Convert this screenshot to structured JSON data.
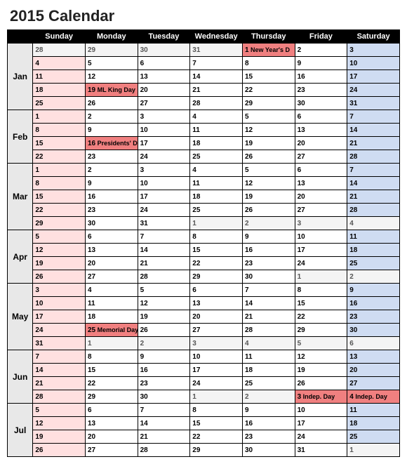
{
  "title": "2015 Calendar",
  "headers": [
    "",
    "Sunday",
    "Monday",
    "Tuesday",
    "Wednesday",
    "Thursday",
    "Friday",
    "Saturday"
  ],
  "months": [
    {
      "label": "Jan",
      "weeks": [
        [
          {
            "d": "28",
            "g": true
          },
          {
            "d": "29",
            "g": true
          },
          {
            "d": "30",
            "g": true
          },
          {
            "d": "31",
            "g": true
          },
          {
            "d": "1",
            "e": "New Year's D"
          },
          {
            "d": "2"
          },
          {
            "d": "3"
          }
        ],
        [
          {
            "d": "4"
          },
          {
            "d": "5"
          },
          {
            "d": "6"
          },
          {
            "d": "7"
          },
          {
            "d": "8"
          },
          {
            "d": "9"
          },
          {
            "d": "10"
          }
        ],
        [
          {
            "d": "11"
          },
          {
            "d": "12"
          },
          {
            "d": "13"
          },
          {
            "d": "14"
          },
          {
            "d": "15"
          },
          {
            "d": "16"
          },
          {
            "d": "17"
          }
        ],
        [
          {
            "d": "18"
          },
          {
            "d": "19",
            "e": "ML King Day"
          },
          {
            "d": "20"
          },
          {
            "d": "21"
          },
          {
            "d": "22"
          },
          {
            "d": "23"
          },
          {
            "d": "24"
          }
        ],
        [
          {
            "d": "25"
          },
          {
            "d": "26"
          },
          {
            "d": "27"
          },
          {
            "d": "28"
          },
          {
            "d": "29"
          },
          {
            "d": "30"
          },
          {
            "d": "31"
          }
        ]
      ]
    },
    {
      "label": "Feb",
      "weeks": [
        [
          {
            "d": "1"
          },
          {
            "d": "2"
          },
          {
            "d": "3"
          },
          {
            "d": "4"
          },
          {
            "d": "5"
          },
          {
            "d": "6"
          },
          {
            "d": "7"
          }
        ],
        [
          {
            "d": "8"
          },
          {
            "d": "9"
          },
          {
            "d": "10"
          },
          {
            "d": "11"
          },
          {
            "d": "12"
          },
          {
            "d": "13"
          },
          {
            "d": "14"
          }
        ],
        [
          {
            "d": "15"
          },
          {
            "d": "16",
            "e": "Presidents' D"
          },
          {
            "d": "17"
          },
          {
            "d": "18"
          },
          {
            "d": "19"
          },
          {
            "d": "20"
          },
          {
            "d": "21"
          }
        ],
        [
          {
            "d": "22"
          },
          {
            "d": "23"
          },
          {
            "d": "24"
          },
          {
            "d": "25"
          },
          {
            "d": "26"
          },
          {
            "d": "27"
          },
          {
            "d": "28"
          }
        ]
      ]
    },
    {
      "label": "Mar",
      "weeks": [
        [
          {
            "d": "1"
          },
          {
            "d": "2"
          },
          {
            "d": "3"
          },
          {
            "d": "4"
          },
          {
            "d": "5"
          },
          {
            "d": "6"
          },
          {
            "d": "7"
          }
        ],
        [
          {
            "d": "8"
          },
          {
            "d": "9"
          },
          {
            "d": "10"
          },
          {
            "d": "11"
          },
          {
            "d": "12"
          },
          {
            "d": "13"
          },
          {
            "d": "14"
          }
        ],
        [
          {
            "d": "15"
          },
          {
            "d": "16"
          },
          {
            "d": "17"
          },
          {
            "d": "18"
          },
          {
            "d": "19"
          },
          {
            "d": "20"
          },
          {
            "d": "21"
          }
        ],
        [
          {
            "d": "22"
          },
          {
            "d": "23"
          },
          {
            "d": "24"
          },
          {
            "d": "25"
          },
          {
            "d": "26"
          },
          {
            "d": "27"
          },
          {
            "d": "28"
          }
        ],
        [
          {
            "d": "29"
          },
          {
            "d": "30"
          },
          {
            "d": "31"
          },
          {
            "d": "1",
            "g": true
          },
          {
            "d": "2",
            "g": true
          },
          {
            "d": "3",
            "g": true
          },
          {
            "d": "4",
            "g": true
          }
        ]
      ]
    },
    {
      "label": "Apr",
      "weeks": [
        [
          {
            "d": "5"
          },
          {
            "d": "6"
          },
          {
            "d": "7"
          },
          {
            "d": "8"
          },
          {
            "d": "9"
          },
          {
            "d": "10"
          },
          {
            "d": "11"
          }
        ],
        [
          {
            "d": "12"
          },
          {
            "d": "13"
          },
          {
            "d": "14"
          },
          {
            "d": "15"
          },
          {
            "d": "16"
          },
          {
            "d": "17"
          },
          {
            "d": "18"
          }
        ],
        [
          {
            "d": "19"
          },
          {
            "d": "20"
          },
          {
            "d": "21"
          },
          {
            "d": "22"
          },
          {
            "d": "23"
          },
          {
            "d": "24"
          },
          {
            "d": "25"
          }
        ],
        [
          {
            "d": "26"
          },
          {
            "d": "27"
          },
          {
            "d": "28"
          },
          {
            "d": "29"
          },
          {
            "d": "30"
          },
          {
            "d": "1",
            "g": true
          },
          {
            "d": "2",
            "g": true
          }
        ]
      ]
    },
    {
      "label": "May",
      "weeks": [
        [
          {
            "d": "3"
          },
          {
            "d": "4"
          },
          {
            "d": "5"
          },
          {
            "d": "6"
          },
          {
            "d": "7"
          },
          {
            "d": "8"
          },
          {
            "d": "9"
          }
        ],
        [
          {
            "d": "10"
          },
          {
            "d": "11"
          },
          {
            "d": "12"
          },
          {
            "d": "13"
          },
          {
            "d": "14"
          },
          {
            "d": "15"
          },
          {
            "d": "16"
          }
        ],
        [
          {
            "d": "17"
          },
          {
            "d": "18"
          },
          {
            "d": "19"
          },
          {
            "d": "20"
          },
          {
            "d": "21"
          },
          {
            "d": "22"
          },
          {
            "d": "23"
          }
        ],
        [
          {
            "d": "24"
          },
          {
            "d": "25",
            "e": "Memorial Day"
          },
          {
            "d": "26"
          },
          {
            "d": "27"
          },
          {
            "d": "28"
          },
          {
            "d": "29"
          },
          {
            "d": "30"
          }
        ],
        [
          {
            "d": "31"
          },
          {
            "d": "1",
            "g": true
          },
          {
            "d": "2",
            "g": true
          },
          {
            "d": "3",
            "g": true
          },
          {
            "d": "4",
            "g": true
          },
          {
            "d": "5",
            "g": true
          },
          {
            "d": "6",
            "g": true
          }
        ]
      ]
    },
    {
      "label": "Jun",
      "weeks": [
        [
          {
            "d": "7"
          },
          {
            "d": "8"
          },
          {
            "d": "9"
          },
          {
            "d": "10"
          },
          {
            "d": "11"
          },
          {
            "d": "12"
          },
          {
            "d": "13"
          }
        ],
        [
          {
            "d": "14"
          },
          {
            "d": "15"
          },
          {
            "d": "16"
          },
          {
            "d": "17"
          },
          {
            "d": "18"
          },
          {
            "d": "19"
          },
          {
            "d": "20"
          }
        ],
        [
          {
            "d": "21"
          },
          {
            "d": "22"
          },
          {
            "d": "23"
          },
          {
            "d": "24"
          },
          {
            "d": "25"
          },
          {
            "d": "26"
          },
          {
            "d": "27"
          }
        ],
        [
          {
            "d": "28"
          },
          {
            "d": "29"
          },
          {
            "d": "30"
          },
          {
            "d": "1",
            "g": true
          },
          {
            "d": "2",
            "g": true
          },
          {
            "d": "3",
            "e": "Indep. Day"
          },
          {
            "d": "4",
            "e": "Indep. Day"
          }
        ]
      ]
    },
    {
      "label": "Jul",
      "weeks": [
        [
          {
            "d": "5"
          },
          {
            "d": "6"
          },
          {
            "d": "7"
          },
          {
            "d": "8"
          },
          {
            "d": "9"
          },
          {
            "d": "10"
          },
          {
            "d": "11"
          }
        ],
        [
          {
            "d": "12"
          },
          {
            "d": "13"
          },
          {
            "d": "14"
          },
          {
            "d": "15"
          },
          {
            "d": "16"
          },
          {
            "d": "17"
          },
          {
            "d": "18"
          }
        ],
        [
          {
            "d": "19"
          },
          {
            "d": "20"
          },
          {
            "d": "21"
          },
          {
            "d": "22"
          },
          {
            "d": "23"
          },
          {
            "d": "24"
          },
          {
            "d": "25"
          }
        ],
        [
          {
            "d": "26"
          },
          {
            "d": "27"
          },
          {
            "d": "28"
          },
          {
            "d": "29"
          },
          {
            "d": "30"
          },
          {
            "d": "31"
          },
          {
            "d": "1",
            "g": true
          }
        ]
      ]
    }
  ]
}
